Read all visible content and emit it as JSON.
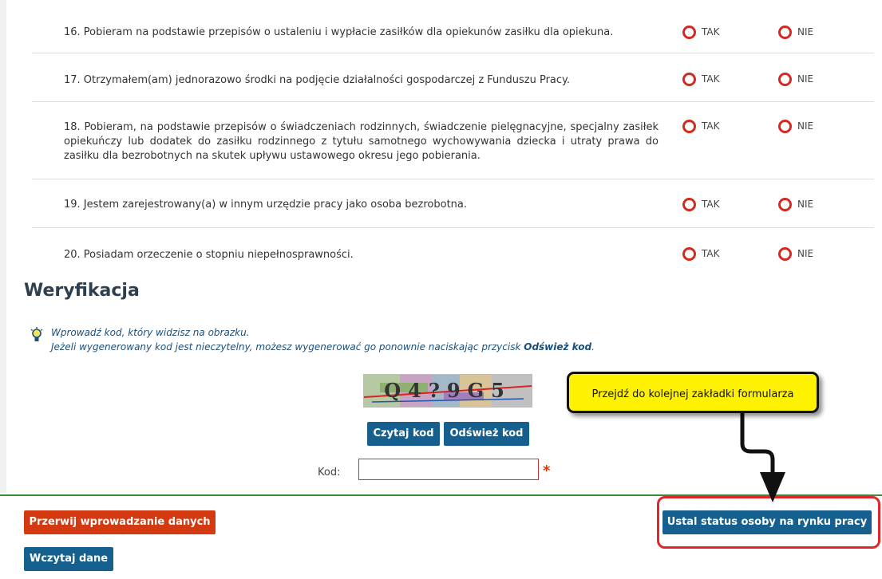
{
  "questions": [
    {
      "text": "16. Pobieram na podstawie przepisów o ustaleniu i wypłacie zasiłków dla opiekunów zasiłku dla opiekuna.",
      "yes": "TAK",
      "no": "NIE"
    },
    {
      "text": "17. Otrzymałem(am) jednorazowo środki na podjęcie działalności gospodarczej z Funduszu Pracy.",
      "yes": "TAK",
      "no": "NIE"
    },
    {
      "text": "18. Pobieram, na podstawie przepisów o świadczeniach rodzinnych, świadczenie pielęgnacyjne, specjalny zasiłek opiekuńczy lub dodatek do zasiłku rodzinnego z tytułu samotnego wychowywania dziecka i utraty prawa do zasiłku dla bezrobotnych na skutek upływu ustawowego okresu jego pobierania.",
      "yes": "TAK",
      "no": "NIE"
    },
    {
      "text": "19. Jestem zarejestrowany(a) w innym urzędzie pracy jako osoba bezrobotna.",
      "yes": "TAK",
      "no": "NIE"
    },
    {
      "text": "20. Posiadam orzeczenie o stopniu niepełnosprawności.",
      "yes": "TAK",
      "no": "NIE"
    }
  ],
  "verification": {
    "title": "Weryfikacja",
    "hint_line1": "Wprowadź kod, który widzisz na obrazku.",
    "hint_line2": "Jeżeli wygenerowany kod jest nieczytelny, możesz wygenerować go ponownie naciskając przycisk",
    "hint_button_name": "Odśwież kod",
    "hint_end": ".",
    "captcha_text": "Q4?9G5",
    "read_code_button": "Czytaj kod",
    "refresh_code_button": "Odśwież kod",
    "code_label": "Kod:",
    "code_value": "",
    "required_mark": "*"
  },
  "footer": {
    "cancel_button": "Przerwij wprowadzanie danych",
    "load_button": "Wczytaj dane",
    "next_button": "Ustal status osoby na rynku pracy"
  },
  "annotation": {
    "callout_text": "Przejdź do kolejnej zakładki formularza"
  },
  "colors": {
    "primary_button": "#15608e",
    "danger_button": "#d43a11",
    "radio_ring": "#d22a22",
    "callout_bg": "#fff200",
    "frame": "#e0262a"
  }
}
